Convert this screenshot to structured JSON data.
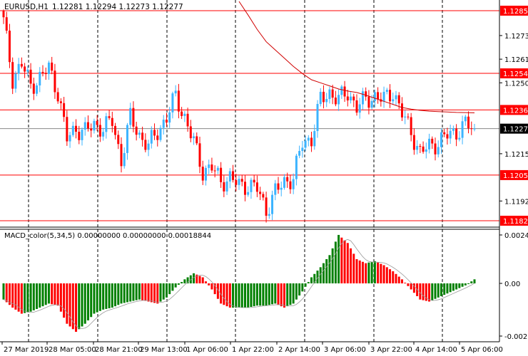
{
  "header": {
    "symbol": "EURUSD,H1",
    "ohlc": "1.12281 1.12294 1.12273 1.12277"
  },
  "macd_header": {
    "label": "MACD_color(5,34,5) 0.00000000 0.00000000 0.00018844"
  },
  "colors": {
    "up": "#1e90ff",
    "up_fill": "#3cb4ff",
    "down": "#ff0000",
    "level": "#ff0000",
    "bid": "#000000",
    "hist_up": "#008000",
    "hist_down": "#ff0000",
    "ma": "#d00000"
  },
  "chart_data": {
    "type": "candlestick",
    "title": "EURUSD,H1",
    "price_ylim": [
      1.11829,
      1.12851
    ],
    "price_ticks": [
      "1.12730",
      "1.12615",
      "1.12500",
      "1.12155",
      "1.11925"
    ],
    "levels": [
      "1.12851",
      "1.12546",
      "1.12368",
      "1.12051",
      "1.11829"
    ],
    "bid": "1.12277",
    "x_tick_labels": [
      "27 Mar 2019",
      "28 Mar 05:00",
      "28 Mar 21:00",
      "29 Mar 13:00",
      "1 Apr 06:00",
      "1 Apr 22:00",
      "2 Apr 14:00",
      "3 Apr 06:00",
      "3 Apr 22:00",
      "4 Apr 14:00",
      "5 Apr 06:00"
    ],
    "close_anchors": [
      1.12799,
      1.12522,
      1.12591,
      1.12487,
      1.12522,
      1.12574,
      1.12453,
      1.12227,
      1.12279,
      1.12262,
      1.12297,
      1.12279,
      1.12314,
      1.12123,
      1.12331,
      1.12245,
      1.12193,
      1.12262,
      1.12331,
      1.12435,
      1.12331,
      1.1221,
      1.12071,
      1.12089,
      1.1202,
      1.12037,
      1.12002,
      1.12002,
      1.11985,
      1.11881,
      1.11967,
      1.1202,
      1.12037,
      1.1221,
      1.12227,
      1.12418,
      1.12453,
      1.12418,
      1.12453,
      1.12383,
      1.12418,
      1.12435,
      1.12418,
      1.1246,
      1.12349,
      1.12262,
      1.12158,
      1.12193,
      1.1221,
      1.12245,
      1.12262,
      1.12297,
      1.12277
    ],
    "ma_anchor_start": 26,
    "ma_anchors": [
      1.12896,
      1.1283,
      1.1276,
      1.127,
      1.1266,
      1.1262,
      1.1258,
      1.12545,
      1.12515,
      1.125,
      1.12485,
      1.1247,
      1.1246,
      1.12453,
      1.1244,
      1.12425,
      1.1241,
      1.12395,
      1.1238,
      1.12372,
      1.12366,
      1.12362,
      1.1236,
      1.12358,
      1.12356,
      1.12355,
      1.12354
    ],
    "macd": {
      "label": "MACD_color(5,34,5)",
      "ylim": [
        -0.0026376,
        0.0024684
      ],
      "ticks": [
        "0.0024684",
        "0.00",
        "-0.0026376"
      ],
      "histogram_anchors_e4": [
        -8,
        -12,
        -15,
        -14,
        -12,
        -10,
        -11,
        -20,
        -24,
        -20,
        -15,
        -13,
        -12,
        -10,
        -9,
        -8,
        -9,
        -10,
        -7,
        -2,
        2,
        5,
        3,
        -3,
        -10,
        -12,
        -12,
        -12,
        -11,
        -11,
        -10,
        -12,
        -10,
        -4,
        3,
        8,
        14,
        24,
        20,
        12,
        10,
        11,
        9,
        6,
        2,
        -3,
        -8,
        -9,
        -7,
        -5,
        -3,
        -1,
        2
      ]
    }
  }
}
